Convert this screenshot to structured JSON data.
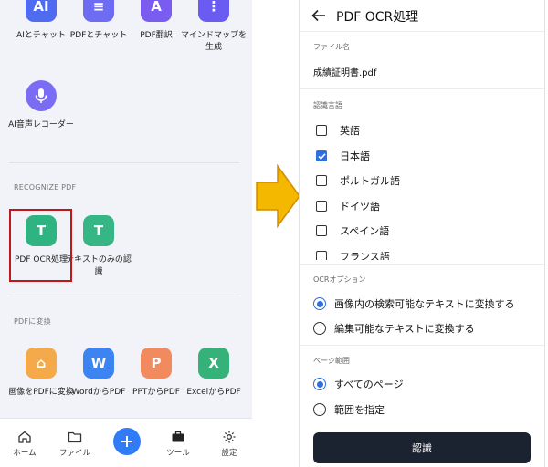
{
  "left": {
    "row1": [
      {
        "label": "AIとチャット",
        "icon": "ai-chat-icon",
        "glyph": "AI",
        "color": "#4f6cf0"
      },
      {
        "label": "PDFとチャット",
        "icon": "pdf-chat-icon",
        "glyph": "≡",
        "color": "#6d6cf2"
      },
      {
        "label": "PDF翻訳",
        "icon": "pdf-translate-icon",
        "glyph": "A",
        "color": "#7a5cf0"
      },
      {
        "label": "マインドマップを生成",
        "icon": "mindmap-icon",
        "glyph": "⋮",
        "color": "#6a5cf2"
      }
    ],
    "voice": {
      "label": "AI音声レコーダー",
      "icon": "voice-recorder-icon",
      "color": "#7b6cf6"
    },
    "recognize_section": "RECOGNIZE PDF",
    "recognize": [
      {
        "label": "PDF OCR処理",
        "icon": "pdf-ocr-icon",
        "glyph": "T",
        "color": "#2fb382"
      },
      {
        "label": "テキストのみの認識",
        "icon": "text-recognition-icon",
        "glyph": "T",
        "color": "#36b684"
      }
    ],
    "convert_section": "PDFに変換",
    "convert": [
      {
        "label": "画像をPDFに変換",
        "icon": "image-to-pdf-icon",
        "glyph": "⌂",
        "color": "#f4a94a"
      },
      {
        "label": "WordからPDF",
        "icon": "word-to-pdf-icon",
        "glyph": "W",
        "color": "#3c84f2"
      },
      {
        "label": "PPTからPDF",
        "icon": "ppt-to-pdf-icon",
        "glyph": "P",
        "color": "#f28a5f"
      },
      {
        "label": "ExcelからPDF",
        "icon": "excel-to-pdf-icon",
        "glyph": "X",
        "color": "#34b27a"
      }
    ],
    "nav": {
      "home": "ホーム",
      "files": "ファイル",
      "tools": "ツール",
      "settings": "設定"
    }
  },
  "right": {
    "title": "PDF OCR処理",
    "file_label": "ファイル名",
    "file_name": "成績証明書.pdf",
    "lang_label": "認識言語",
    "languages": [
      {
        "label": "英語",
        "checked": false
      },
      {
        "label": "日本語",
        "checked": true
      },
      {
        "label": "ポルトガル語",
        "checked": false
      },
      {
        "label": "ドイツ語",
        "checked": false
      },
      {
        "label": "スペイン語",
        "checked": false
      },
      {
        "label": "フランス語",
        "checked": false
      }
    ],
    "ocr_label": "OCRオプション",
    "ocr_options": [
      {
        "label": "画像内の検索可能なテキストに変換する",
        "selected": true
      },
      {
        "label": "編集可能なテキストに変換する",
        "selected": false
      }
    ],
    "range_label": "ページ範囲",
    "range_options": [
      {
        "label": "すべてのページ",
        "selected": true
      },
      {
        "label": "範囲を指定",
        "selected": false
      }
    ],
    "button": "認識"
  },
  "colors": {
    "accent": "#2f6fe0",
    "highlight": "#c0171d",
    "arrow": "#f5b800",
    "button": "#1c2330"
  }
}
